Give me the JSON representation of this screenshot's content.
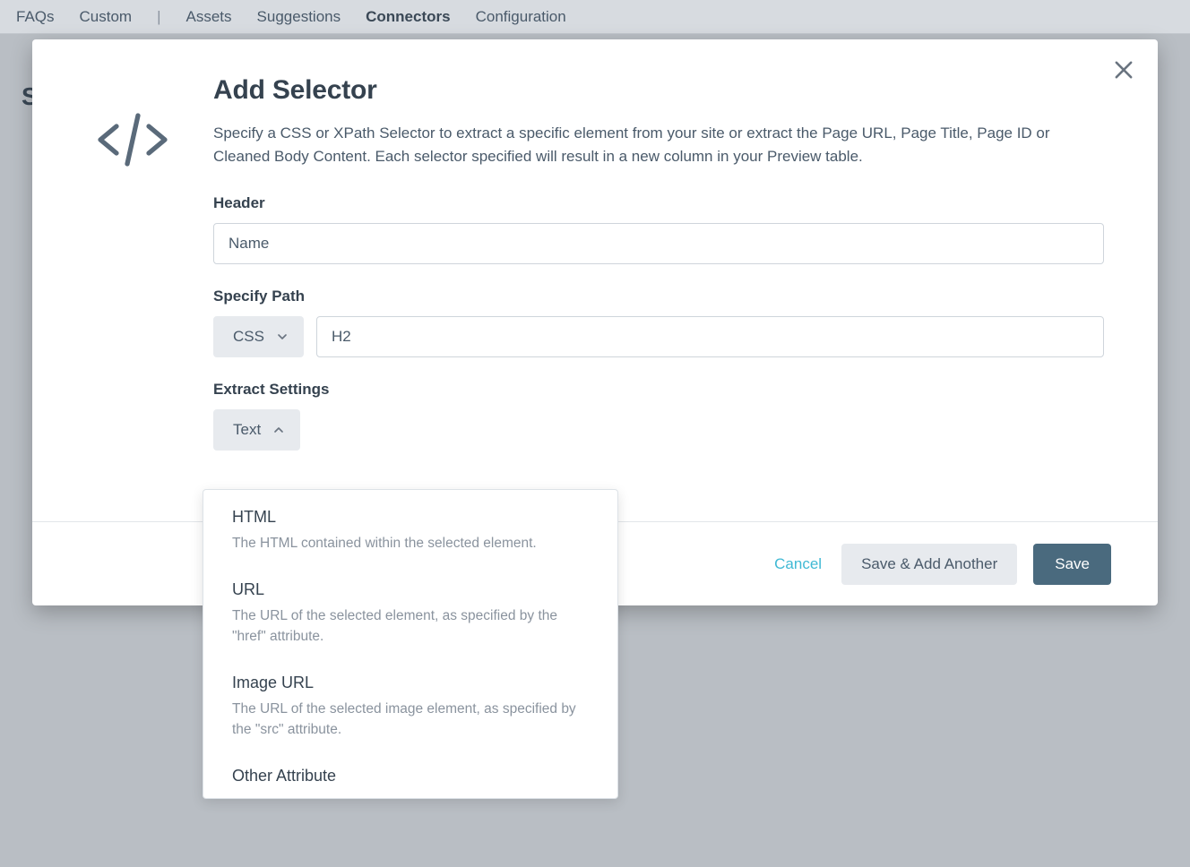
{
  "nav": {
    "items": [
      "FAQs",
      "Custom",
      "|",
      "Assets",
      "Suggestions",
      "Connectors",
      "Configuration"
    ],
    "active_index": 5
  },
  "background": {
    "partial_text": "S"
  },
  "modal": {
    "title": "Add Selector",
    "description": "Specify a CSS or XPath Selector to extract a specific element from your site or extract the Page URL, Page Title, Page ID or Cleaned Body Content. Each selector specified will result in a new column in your Preview table.",
    "header_label": "Header",
    "header_value": "Name",
    "specify_path_label": "Specify Path",
    "path_type": "CSS",
    "path_value": "H2",
    "extract_label": "Extract Settings",
    "extract_value": "Text",
    "footer": {
      "cancel": "Cancel",
      "save_another": "Save & Add Another",
      "save": "Save"
    }
  },
  "dropdown": {
    "options": [
      {
        "title": "HTML",
        "desc": "The HTML contained within the selected element."
      },
      {
        "title": "URL",
        "desc": "The URL of the selected element, as specified by the \"href\" attribute."
      },
      {
        "title": "Image URL",
        "desc": "The URL of the selected image element, as specified by the \"src\" attribute."
      },
      {
        "title": "Other Attribute",
        "desc": ""
      }
    ]
  }
}
